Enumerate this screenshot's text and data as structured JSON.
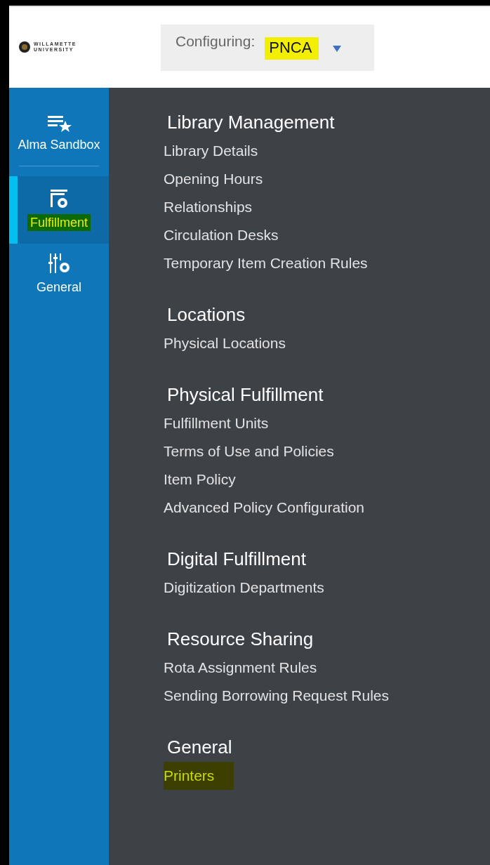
{
  "header": {
    "logo": {
      "line_1": "WILLAMETTE",
      "line_2": "UNIVERSITY"
    },
    "configuring": {
      "label": "Configuring:",
      "value": "PNCA",
      "highlighted": true
    }
  },
  "sidebar": {
    "items": [
      {
        "kind": "star-list",
        "label": "Alma Sandbox",
        "selected": false,
        "highlighted": false
      },
      {
        "kind": "fulfillment",
        "label": "Fulfillment",
        "selected": true,
        "highlighted": true
      },
      {
        "kind": "sliders",
        "label": "General",
        "selected": false,
        "highlighted": false
      }
    ]
  },
  "sections": [
    {
      "title": "Library Management",
      "items": [
        {
          "label": "Library Details",
          "highlighted": false
        },
        {
          "label": "Opening Hours",
          "highlighted": false
        },
        {
          "label": "Relationships",
          "highlighted": false
        },
        {
          "label": "Circulation Desks",
          "highlighted": false
        },
        {
          "label": "Temporary Item Creation Rules",
          "highlighted": false
        }
      ]
    },
    {
      "title": "Locations",
      "items": [
        {
          "label": "Physical Locations",
          "highlighted": false
        }
      ]
    },
    {
      "title": "Physical Fulfillment",
      "items": [
        {
          "label": "Fulfillment Units",
          "highlighted": false
        },
        {
          "label": "Terms of Use and Policies",
          "highlighted": false
        },
        {
          "label": "Item Policy",
          "highlighted": false
        },
        {
          "label": "Advanced Policy Configuration",
          "highlighted": false
        }
      ]
    },
    {
      "title": "Digital Fulfillment",
      "items": [
        {
          "label": "Digitization Departments",
          "highlighted": false
        }
      ]
    },
    {
      "title": "Resource Sharing",
      "items": [
        {
          "label": "Rota Assignment Rules",
          "highlighted": false
        },
        {
          "label": "Sending Borrowing Request Rules",
          "highlighted": false
        }
      ]
    },
    {
      "title": "General",
      "items": [
        {
          "label": "Printers",
          "highlighted": true
        }
      ]
    }
  ]
}
